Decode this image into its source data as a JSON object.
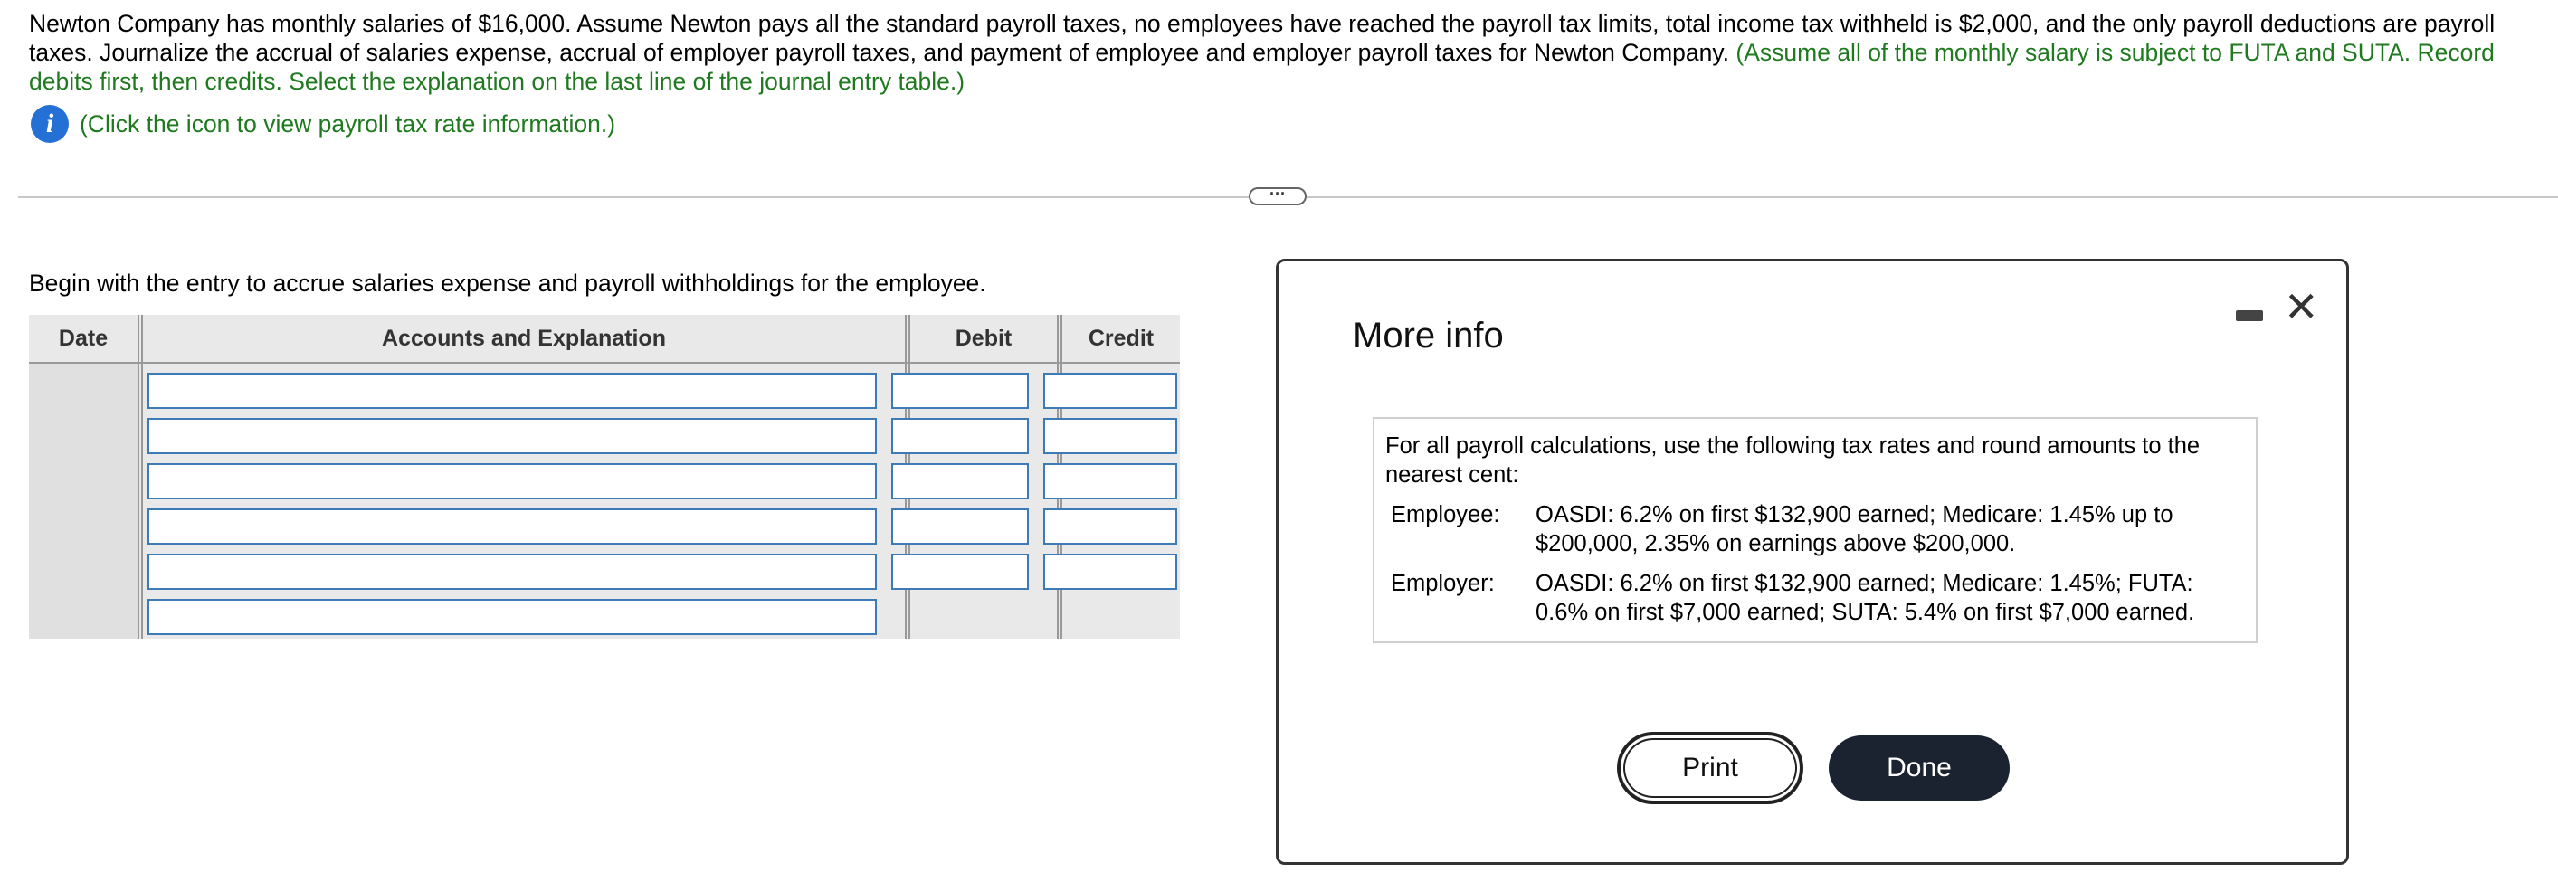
{
  "problem": {
    "text_main": "Newton Company has monthly salaries of $16,000. Assume Newton pays all the standard payroll taxes, no employees have reached the payroll tax limits, total income tax withheld is $2,000, and the only payroll deductions are payroll taxes. Journalize the accrual of salaries expense, accrual of employer payroll taxes, and payment of employee and employer payroll taxes for Newton Company.",
    "text_green": "(Assume all of the monthly salary is subject to FUTA and SUTA. Record debits first, then credits. Select the explanation on the last line of the journal entry table.)",
    "hint": "(Click the icon to view payroll tax rate information.)",
    "info_glyph": "i"
  },
  "expander_label": "···",
  "instruction": "Begin with the entry to accrue salaries expense and payroll withholdings for the employee.",
  "journal": {
    "headers": {
      "date": "Date",
      "accounts": "Accounts and Explanation",
      "debit": "Debit",
      "credit": "Credit"
    },
    "rows": [
      {
        "account": "",
        "debit": "",
        "credit": ""
      },
      {
        "account": "",
        "debit": "",
        "credit": ""
      },
      {
        "account": "",
        "debit": "",
        "credit": ""
      },
      {
        "account": "",
        "debit": "",
        "credit": ""
      },
      {
        "account": "",
        "debit": "",
        "credit": ""
      },
      {
        "account": ""
      }
    ]
  },
  "modal": {
    "title": "More info",
    "close_glyph": "✕",
    "intro": "For all payroll calculations, use the following tax rates and round amounts to the nearest cent:",
    "employee_label": "Employee:",
    "employee_text": "OASDI: 6.2% on first $132,900 earned; Medicare: 1.45% up to $200,000, 2.35% on earnings above $200,000.",
    "employer_label": "Employer:",
    "employer_text": "OASDI: 6.2% on first $132,900 earned; Medicare: 1.45%; FUTA: 0.6% on first $7,000 earned; SUTA: 5.4% on first $7,000 earned.",
    "print_label": "Print",
    "done_label": "Done"
  },
  "colors": {
    "green_text": "#1f7a1f",
    "info_icon": "#2470d4",
    "input_border": "#3d7ab8",
    "done_bg": "#1c2330"
  }
}
